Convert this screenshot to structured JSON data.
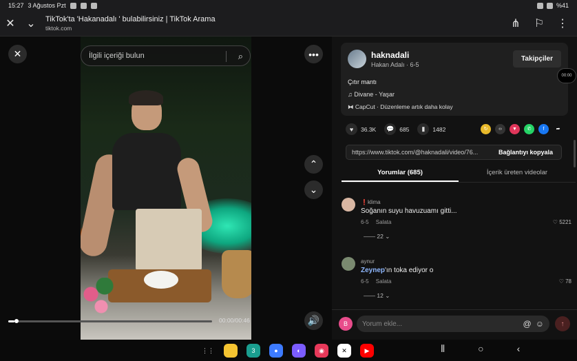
{
  "statusbar": {
    "time": "15:27",
    "date": "3 Ağustos Pzt",
    "battery": "%41"
  },
  "browser": {
    "title": "TikTok'ta 'Hakanadalı ' bulabilirsiniz | TikTok Arama",
    "url": "tiktok.com"
  },
  "search": {
    "placeholder": "İlgili içeriği bulun"
  },
  "video": {
    "time": "00:00/00:46",
    "progress": 0.03
  },
  "author": {
    "username": "haknadali",
    "display": "Hakan Adalı · 6-5",
    "follow_label": "Takipçiler",
    "description": "Çıtır mantı",
    "music": "Divane - Yaşar",
    "capcut": "CapCut · Düzenleme artık daha kolay",
    "timer": "00:00"
  },
  "stats": {
    "likes": "36.3K",
    "comments": "685",
    "saves": "1482"
  },
  "link": {
    "url": "https://www.tiktok.com/@haknadali/video/76...",
    "copy_label": "Bağlantıyı kopyala"
  },
  "tabs": [
    {
      "label": "Yorumlar (685)"
    },
    {
      "label": "İçerik üreten videolar"
    }
  ],
  "comments": [
    {
      "user": "❗klima",
      "text": "Soğanın suyu havuzuamı gitti...",
      "date": "6-5",
      "reply": "Salata",
      "likes": "5221",
      "replies": "22"
    },
    {
      "user": "aynur",
      "mention": "Zeynep",
      "text": "'ın toka ediyor o",
      "date": "6-5",
      "reply": "Salata",
      "likes": "78",
      "replies": "12"
    }
  ],
  "composer": {
    "avatar": "B",
    "placeholder": "Yorum ekle..."
  }
}
